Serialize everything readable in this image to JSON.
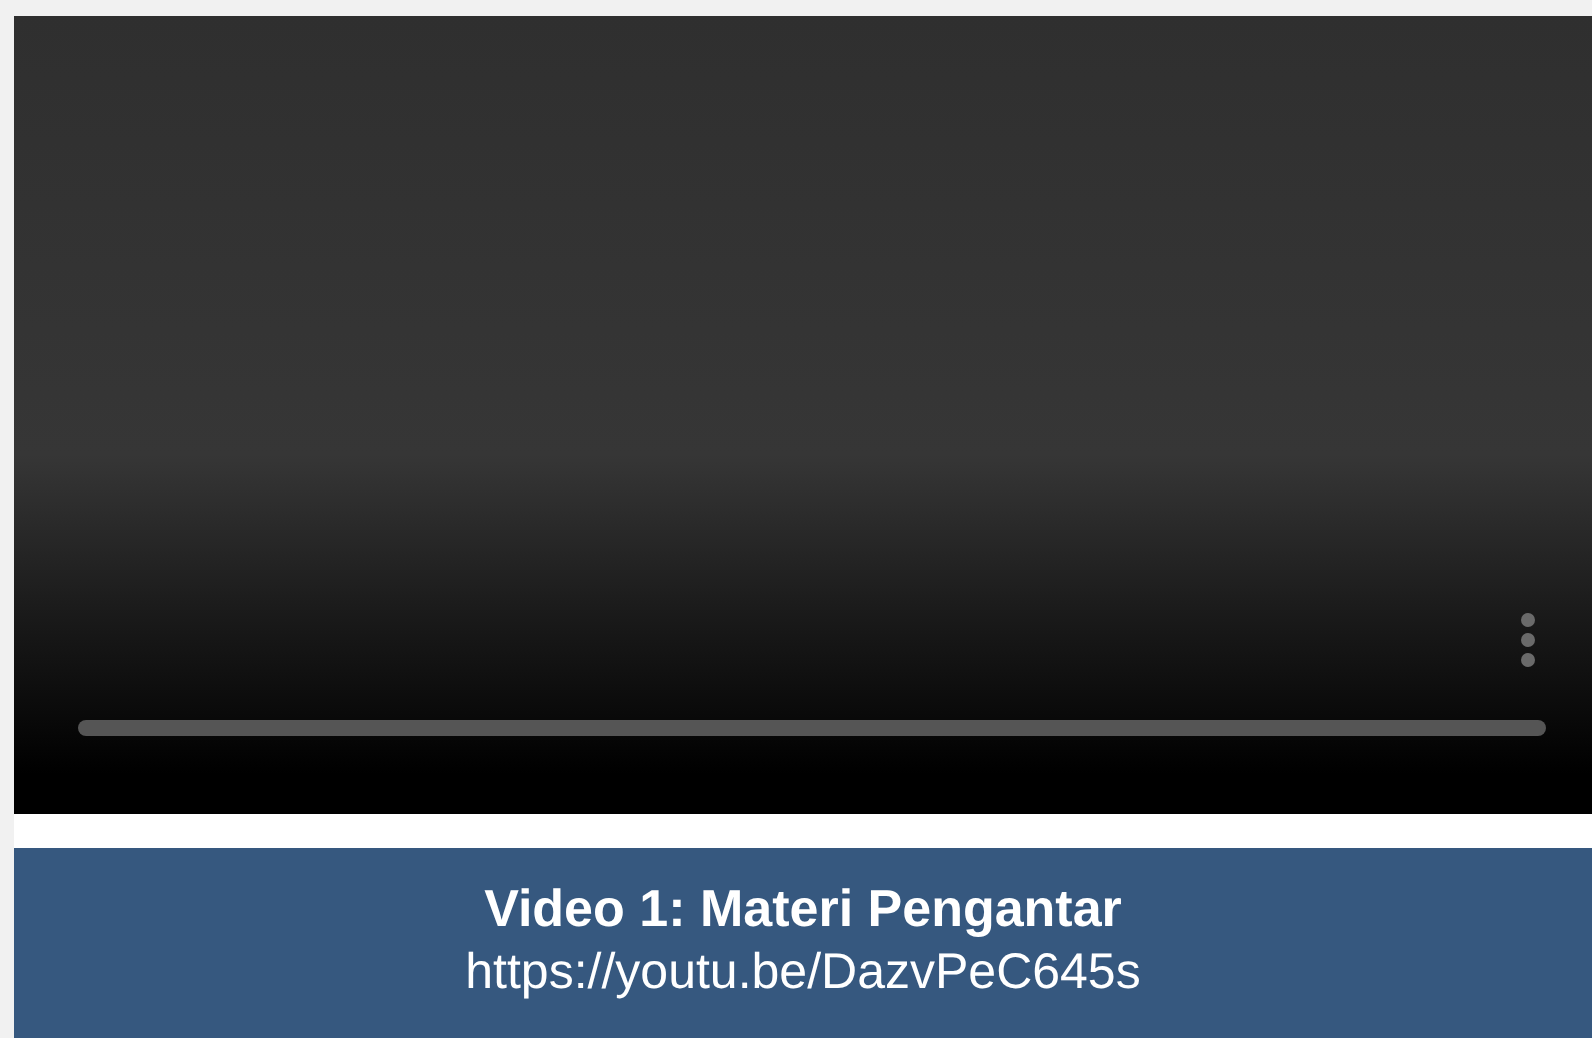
{
  "video": {
    "kind": "player",
    "progress": {
      "level": 0
    }
  },
  "caption": {
    "title": "Video 1: Materi Pengantar",
    "link": "https://youtu.be/DazvPeC645s"
  }
}
